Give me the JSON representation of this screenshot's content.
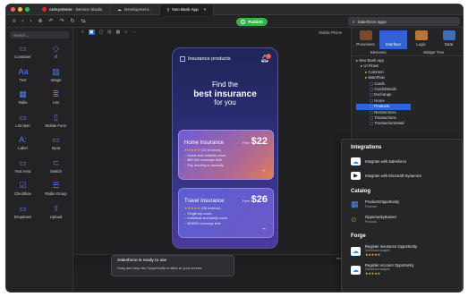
{
  "app": {
    "tabs": [
      {
        "label": "outsystems",
        "suffix": " - Service Studio"
      },
      {
        "label": "Development..."
      },
      {
        "label": "Neo Bank App"
      }
    ]
  },
  "toolbar": {
    "publish_label": "Publish",
    "search_value": "Salesforce apps"
  },
  "left_panel": {
    "search_placeholder": "Search...",
    "widgets": [
      {
        "label": "Container",
        "icon": "container-icon",
        "glyph": "▭"
      },
      {
        "label": "If",
        "icon": "if-icon",
        "glyph": "◇"
      },
      {
        "label": "Text",
        "icon": "text-icon",
        "glyph": "Aa"
      },
      {
        "label": "Image",
        "icon": "image-icon",
        "glyph": "▨"
      },
      {
        "label": "Table",
        "icon": "table-icon",
        "glyph": "▦"
      },
      {
        "label": "List",
        "icon": "list-icon",
        "glyph": "≣"
      },
      {
        "label": "List Item",
        "icon": "list-item-icon",
        "glyph": "▭"
      },
      {
        "label": "Mobile Form",
        "icon": "mobile-form-icon",
        "glyph": "▯"
      },
      {
        "label": "Label",
        "icon": "label-icon",
        "glyph": "A:"
      },
      {
        "label": "Input",
        "icon": "input-icon",
        "glyph": "▭"
      },
      {
        "label": "Text Area",
        "icon": "text-area-icon",
        "glyph": "▭"
      },
      {
        "label": "Switch",
        "icon": "switch-icon",
        "glyph": "⊂"
      },
      {
        "label": "Checkbox",
        "icon": "checkbox-icon",
        "glyph": "☑"
      },
      {
        "label": "Radio Group",
        "icon": "radio-group-icon",
        "glyph": "☰"
      },
      {
        "label": "Dropdown",
        "icon": "dropdown-icon",
        "glyph": "▭"
      },
      {
        "label": "Upload",
        "icon": "upload-icon",
        "glyph": "⇪"
      }
    ]
  },
  "canvas": {
    "device_label": "Mobile Phone",
    "phone": {
      "header_title": "Insurance products",
      "notif_count": "1",
      "hero_line1": "Find the",
      "hero_line2": "best insurance",
      "hero_line3": "for you",
      "cards": [
        {
          "title": "Home Insurance",
          "from": "From",
          "price": "$22",
          "reviews": "(23 reviews)",
          "bullets": [
            "Home and contents cover",
            "$80,000 coverage limit",
            "Pay monthly or annually"
          ]
        },
        {
          "title": "Travel Insurance",
          "from": "From",
          "price": "$26",
          "reviews": "(98 reviews)",
          "bullets": [
            "Single-trip cover",
            "Individual and family cover",
            "$20000 coverage limit"
          ]
        }
      ]
    },
    "toast": {
      "title": "Salesforce is ready to use",
      "body": "Drag and drop the Opportunity entities to your screen."
    },
    "bottom_fragment": "res",
    "side_fragment": "cts.dev",
    "side_fragment2": "<25 on"
  },
  "right_panel": {
    "tabs": [
      {
        "label": "Processes",
        "color": "#7a4a2a"
      },
      {
        "label": "Interface",
        "color": "#2f63d6"
      },
      {
        "label": "Logic",
        "color": "#b8763b"
      },
      {
        "label": "Data",
        "color": "#3c6fb6"
      }
    ],
    "subtabs": [
      "Elements",
      "Widget Tree"
    ],
    "tree": [
      {
        "label": "Neo Bank App",
        "indent": 0
      },
      {
        "label": "UI Flows",
        "indent": 1
      },
      {
        "label": "Common",
        "indent": 2
      },
      {
        "label": "MainFlow",
        "indent": 2
      },
      {
        "label": "Cards",
        "indent": 3
      },
      {
        "label": "CardsDetails",
        "indent": 3
      },
      {
        "label": "Exchange",
        "indent": 3
      },
      {
        "label": "Home",
        "indent": 3
      },
      {
        "label": "Products",
        "indent": 3
      },
      {
        "label": "NeoServices",
        "indent": 3
      },
      {
        "label": "Transactions",
        "indent": 3
      },
      {
        "label": "TransactionDetail",
        "indent": 3
      }
    ],
    "selected_index": 8
  },
  "popup": {
    "integrations_title": "Integrations",
    "integrations": [
      {
        "label": "Integrate with Salesforce",
        "icon": "salesforce-icon"
      },
      {
        "label": "Integrate with Microsoft Dynamics",
        "icon": "dynamics-icon"
      }
    ],
    "catalog_title": "Catalog",
    "catalog": [
      {
        "label": "ProductsOpportunity",
        "sub": "Products"
      },
      {
        "label": "OpportunityBanner",
        "sub": "Products"
      }
    ],
    "forge_title": "Forge",
    "forge": [
      {
        "label": "Register Insurance Opportunity",
        "sub": "Salesforce widgets"
      },
      {
        "label": "Register Account Opportunity",
        "sub": "Salesforce widgets"
      }
    ]
  }
}
